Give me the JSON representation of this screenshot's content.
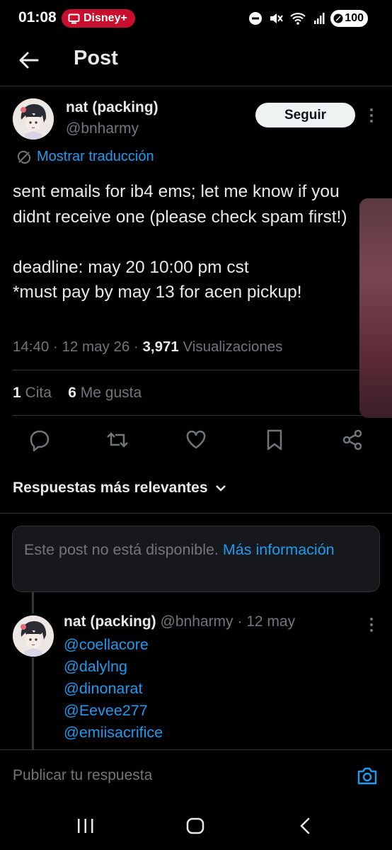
{
  "status_bar": {
    "time": "01:08",
    "notification_app": "Disney+",
    "battery": "100"
  },
  "header": {
    "title": "Post"
  },
  "post": {
    "author_name": "nat (packing)",
    "author_handle": "@bnharmy",
    "follow_label": "Seguir",
    "translate_label": "Mostrar traducción",
    "text": "sent emails for ib4 ems; let me know if you didnt receive one (please check spam first!)\n\ndeadline: may 20 10:00 pm cst\n*must pay by may 13 for acen pickup!",
    "time": "14:40",
    "date": "12 may 26",
    "views_count": "3,971",
    "views_label": "Visualizaciones",
    "quotes_count": "1",
    "quotes_label": "Cita",
    "likes_count": "6",
    "likes_label": "Me gusta"
  },
  "replies": {
    "sort_label": "Respuestas más relevantes",
    "unavailable_text": "Este post no está disponible.",
    "unavailable_link": "Más información",
    "reply": {
      "author_name": "nat (packing)",
      "author_handle": "@bnharmy",
      "date": "· 12 may",
      "mentions": [
        "@coellacore",
        "@dalylng",
        "@dinonarat",
        "@Eevee277",
        "@emiisacrifice"
      ]
    }
  },
  "composer": {
    "placeholder": "Publicar tu respuesta"
  },
  "colors": {
    "accent": "#1d9bf0",
    "background": "#000000",
    "muted": "#71767b",
    "notification_pill": "#c8102e"
  }
}
